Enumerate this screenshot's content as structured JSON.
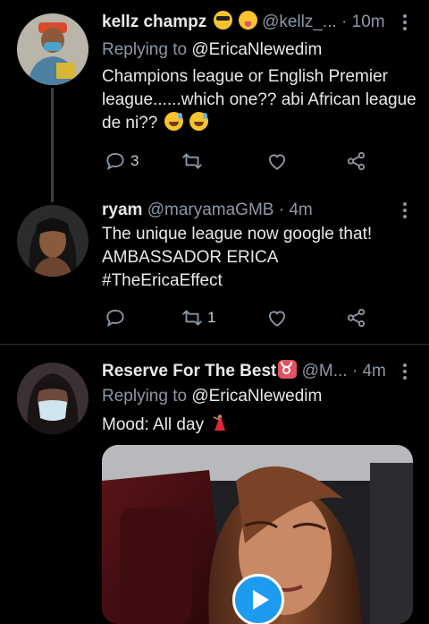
{
  "tweets": [
    {
      "name": "kellz champz",
      "handle": "@kellz_...",
      "time": "10m",
      "replying_prefix": "Replying to ",
      "replying_to": "@EricaNlewedim",
      "text_lines": [
        "Champions league or English Premier",
        "league......which one?? abi African league",
        "de ni??"
      ],
      "name_emojis": [
        "sunglasses-face-emoji",
        "winking-tongue-face-emoji"
      ],
      "body_emojis": [
        "sweat-smile-emoji",
        "sweat-smile-emoji"
      ],
      "reply_count": "3",
      "retweet_count": "",
      "like_count": ""
    },
    {
      "name": "ryam",
      "handle": "@maryamaGMB",
      "time": "4m",
      "text_lines": [
        "The unique league now google that!",
        "AMBASSADOR ERICA",
        "#TheEricaEffect"
      ],
      "reply_count": "",
      "retweet_count": "1",
      "like_count": ""
    },
    {
      "name": "Reserve For The Best",
      "handle": "@M...",
      "time": "4m",
      "replying_prefix": "Replying to ",
      "replying_to": "@EricaNlewedim",
      "text_lines": [
        "Mood: All day"
      ],
      "name_emojis": [
        "taurus-emoji"
      ],
      "body_emojis": [
        "dancer-emoji"
      ],
      "media": "video-thumbnail"
    }
  ],
  "separator": "·",
  "colors": {
    "background": "#000000",
    "text": "#e7e9ea",
    "muted": "#8b98a5",
    "divider": "#2f3336",
    "accent": "#1d9bf0"
  }
}
